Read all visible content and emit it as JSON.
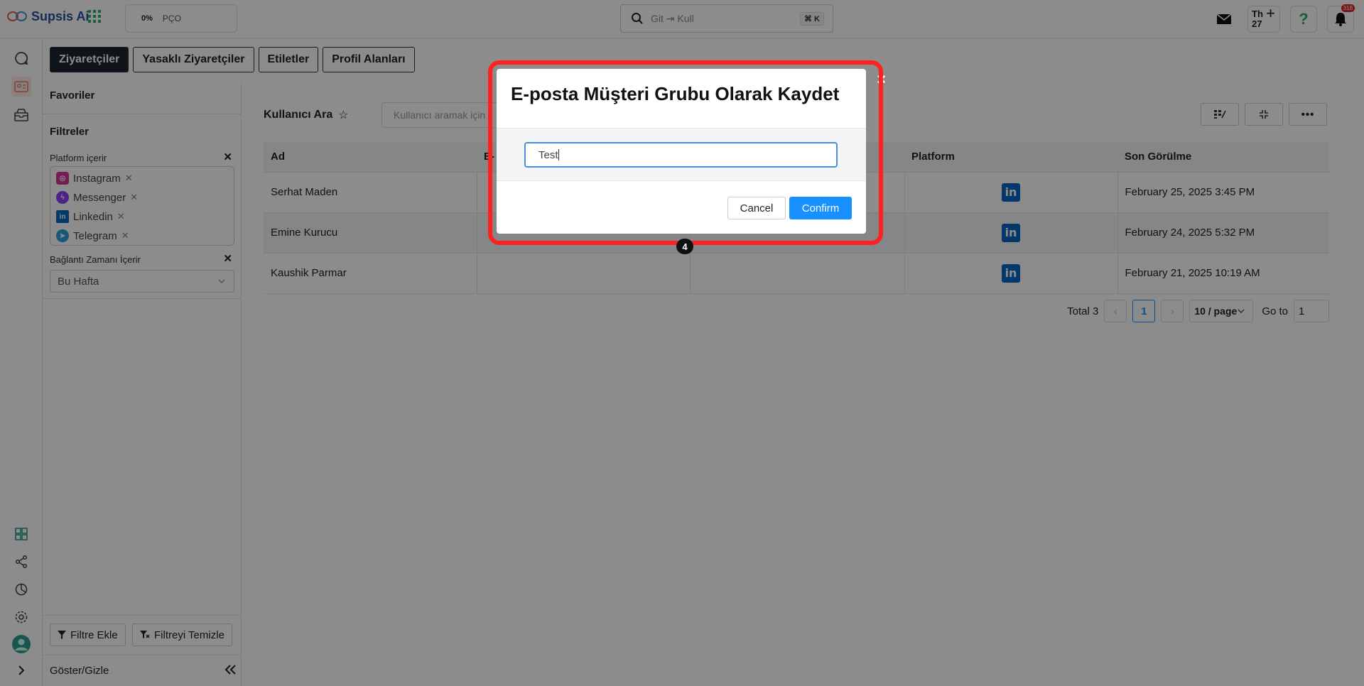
{
  "app": {
    "name": "Supsis Ai"
  },
  "progress": {
    "percent": "0%",
    "label": "PÇO"
  },
  "global_search": {
    "placeholder": "Git ⇥ Kull",
    "shortcut": "⌘ K"
  },
  "topbar": {
    "date_day": "Th",
    "date_num": "27",
    "notification_count": "318"
  },
  "tabs": [
    {
      "label": "Ziyaretçiler",
      "active": true
    },
    {
      "label": "Yasaklı Ziyaretçiler",
      "active": false
    },
    {
      "label": "Etiletler",
      "active": false
    },
    {
      "label": "Profil Alanları",
      "active": false
    }
  ],
  "filters": {
    "favorites_title": "Favoriler",
    "filters_title": "Filtreler",
    "platform_label": "Platform içerir",
    "platforms": [
      "Instagram",
      "Messenger",
      "Linkedin",
      "Telegram"
    ],
    "connection_label": "Bağlantı Zamanı İçerir",
    "connection_value": "Bu Hafta",
    "add_filter": "Filtre Ekle",
    "clear_filter": "Filtreyi Temizle",
    "show_hide": "Göster/Gizle"
  },
  "main": {
    "search_title": "Kullanıcı Ara",
    "search_placeholder": "Kullanıcı aramak için",
    "columns": [
      "Ad",
      "E-",
      "",
      "Platform",
      "Son Görülme"
    ],
    "rows": [
      {
        "name": "Serhat Maden",
        "platform": "in",
        "last_seen": "February 25, 2025 3:45 PM"
      },
      {
        "name": "Emine Kurucu",
        "platform": "in",
        "last_seen": "February 24, 2025 5:32 PM"
      },
      {
        "name": "Kaushik Parmar",
        "platform": "in",
        "last_seen": "February 21, 2025 10:19 AM"
      }
    ],
    "pagination": {
      "total": "Total 3",
      "current": "1",
      "page_size": "10 / page",
      "goto_label": "Go to",
      "goto_value": "1"
    }
  },
  "modal": {
    "title": "E-posta Müşteri Grubu Olarak Kaydet",
    "input_value": "Test",
    "cancel": "Cancel",
    "confirm": "Confirm",
    "close": "×"
  },
  "annotation": {
    "step": "4",
    "color": "#ff2020"
  },
  "colors": {
    "accent": "#1890ff",
    "active_tab": "#1d2330",
    "linkedin": "#0a66c2"
  }
}
